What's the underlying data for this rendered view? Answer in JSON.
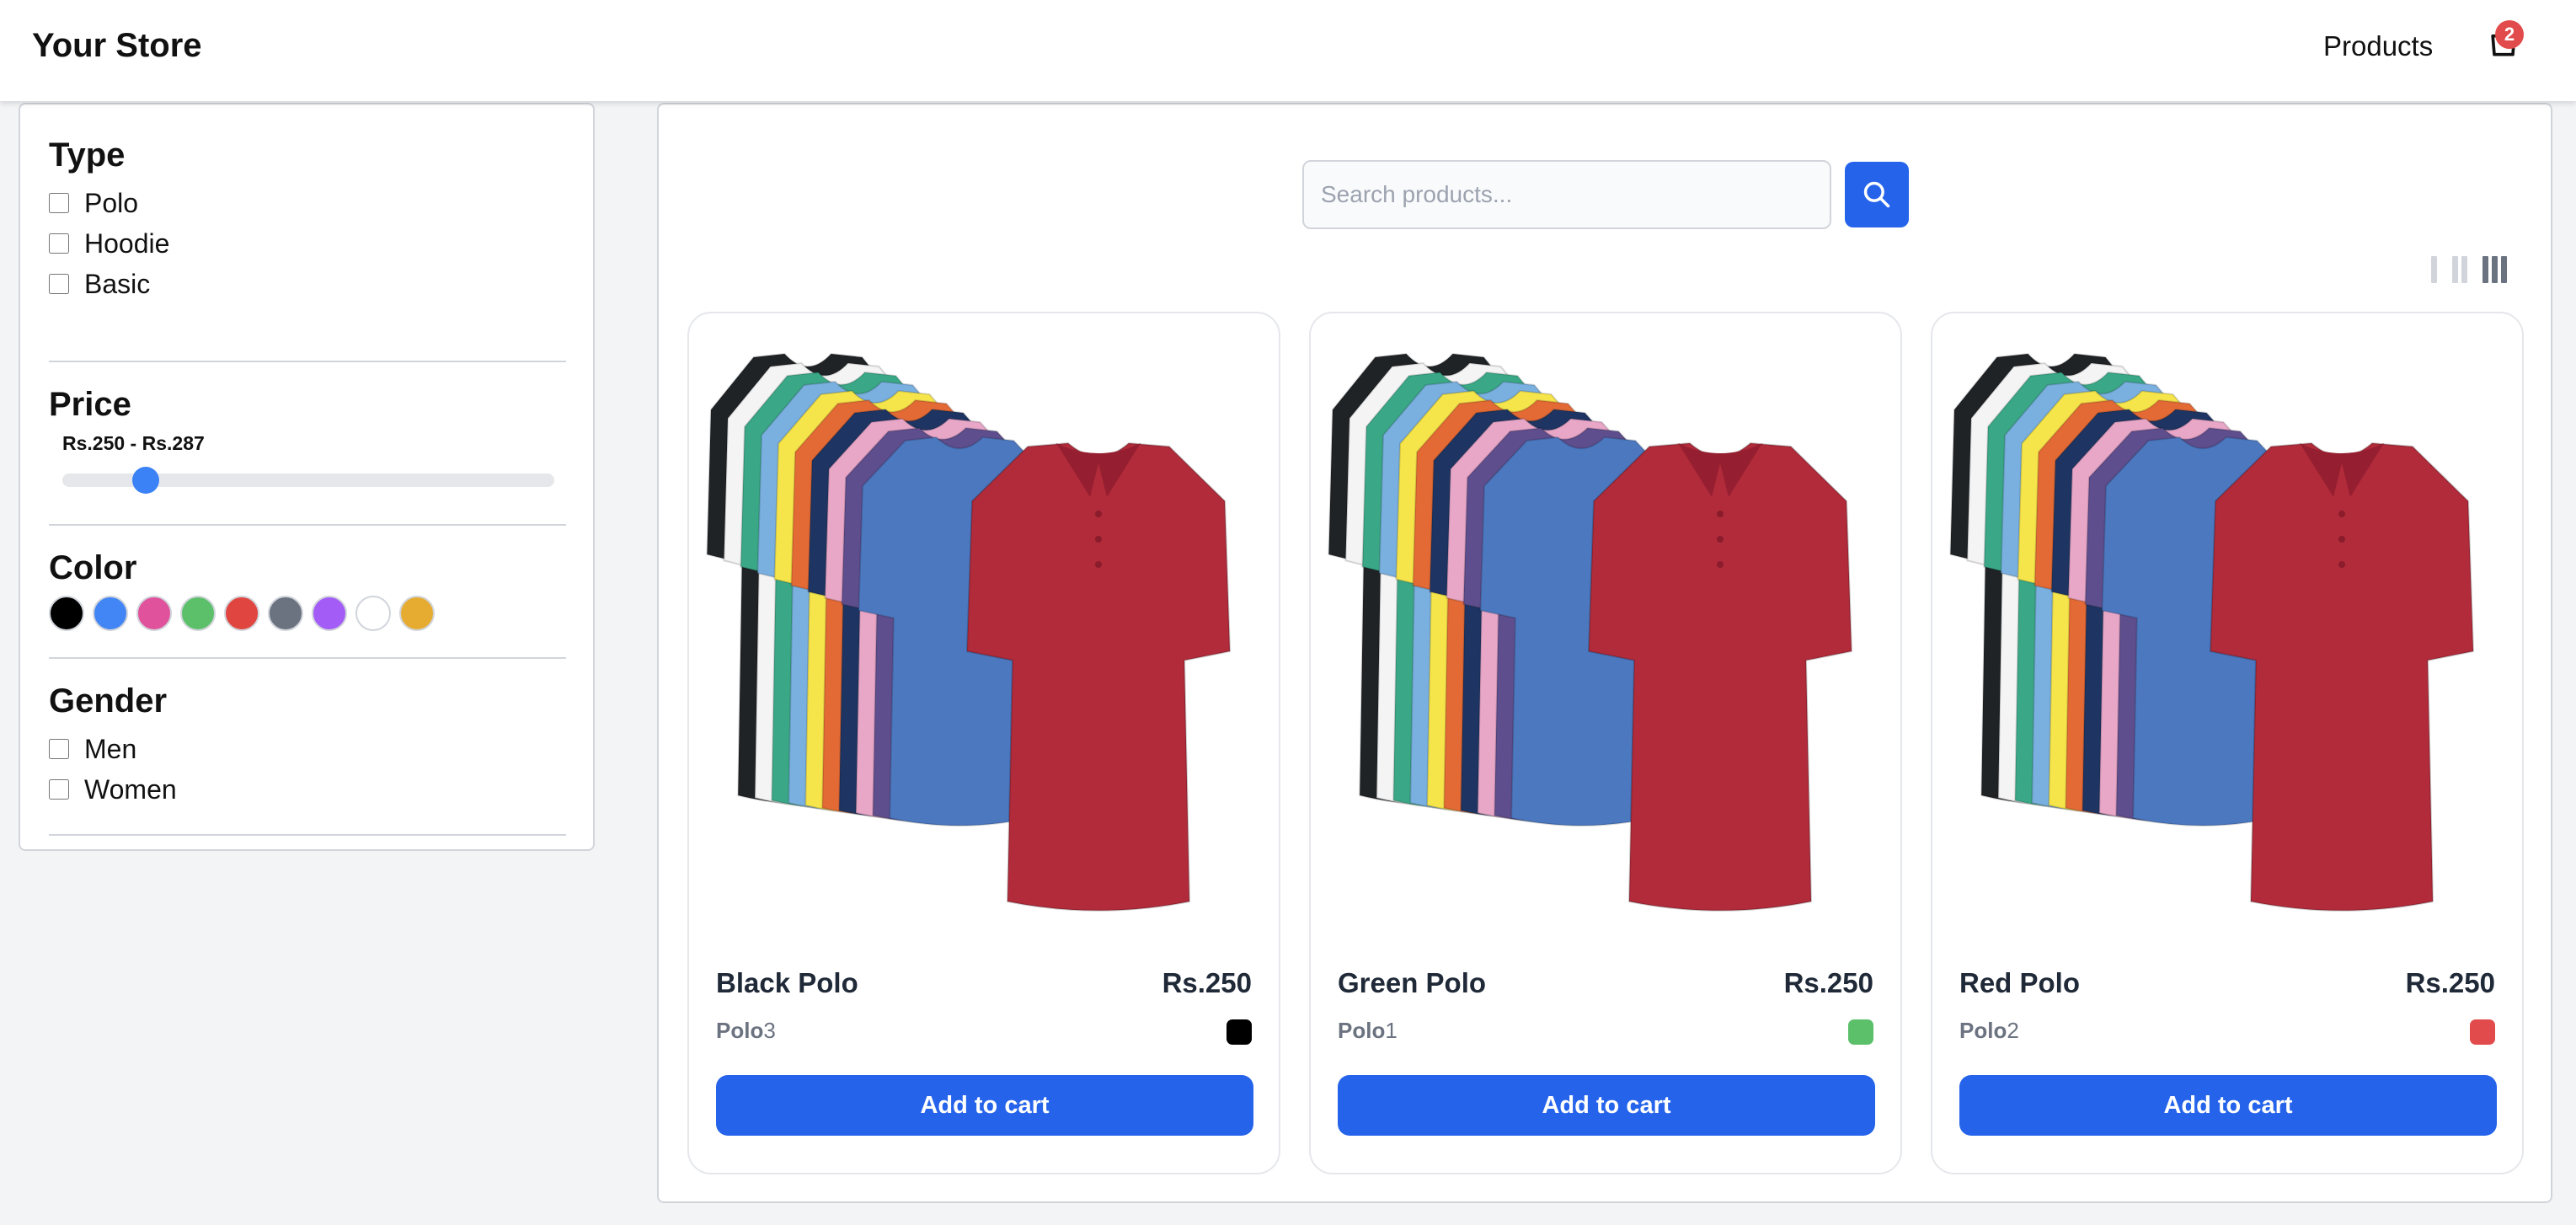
{
  "header": {
    "brand": "Your Store",
    "nav_products": "Products",
    "cart_count": "2"
  },
  "filters": {
    "type": {
      "title": "Type",
      "options": [
        "Polo",
        "Hoodie",
        "Basic"
      ]
    },
    "price": {
      "title": "Price",
      "range_label": "Rs.250 - Rs.287",
      "slider_fraction": 0.17
    },
    "color": {
      "title": "Color",
      "swatches": [
        "#000000",
        "#4285f4",
        "#e0529c",
        "#5cc06a",
        "#e0463f",
        "#6b7280",
        "#a35cf5",
        "#ffffff",
        "#e6ac32"
      ]
    },
    "gender": {
      "title": "Gender",
      "options": [
        "Men",
        "Women"
      ]
    }
  },
  "search": {
    "placeholder": "Search products..."
  },
  "grid_toggle": {
    "active": "3-columns"
  },
  "products": [
    {
      "name": "Black Polo",
      "price": "Rs.250",
      "type": "Polo",
      "sku_num": "3",
      "color": "#000000",
      "button": "Add to cart"
    },
    {
      "name": "Green Polo",
      "price": "Rs.250",
      "type": "Polo",
      "sku_num": "1",
      "color": "#5cc06a",
      "button": "Add to cart"
    },
    {
      "name": "Red Polo",
      "price": "Rs.250",
      "type": "Polo",
      "sku_num": "2",
      "color": "#e24b4b",
      "button": "Add to cart"
    }
  ],
  "polo_colors": [
    "#1f2326",
    "#f4f4f4",
    "#3aa887",
    "#7ab0e0",
    "#f6e54a",
    "#e46a35",
    "#1e3563",
    "#e9a7c8",
    "#5e4e8d",
    "#4c78c0",
    "#b22b3b"
  ]
}
